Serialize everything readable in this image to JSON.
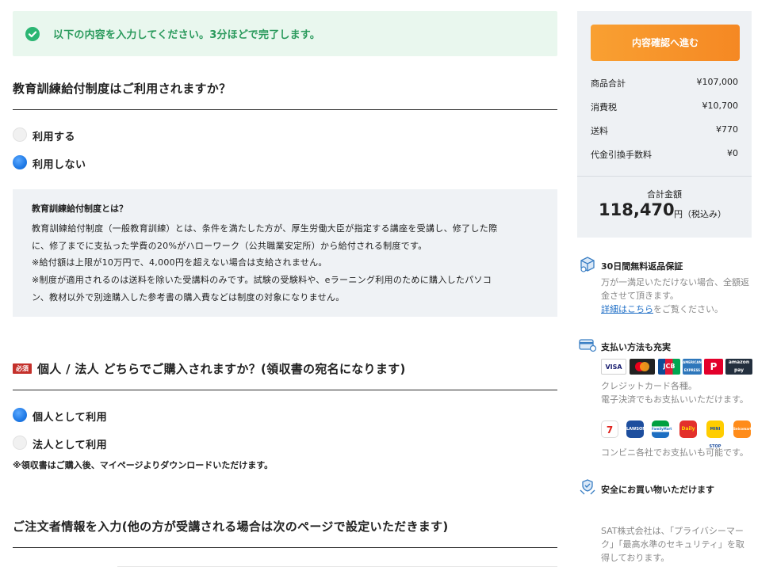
{
  "notice": {
    "text": "以下の内容を入力してください。3分ほどで完了します。"
  },
  "q1": {
    "title": "教育訓練給付制度はご利用されますか？",
    "options": [
      {
        "label": "利用する",
        "selected": false
      },
      {
        "label": "利用しない",
        "selected": true
      }
    ]
  },
  "info": {
    "title": "教育訓練給付制度とは？",
    "lines": [
      "教育訓練給付制度（一般教育訓練）とは、条件を満たした方が、厚生労働大臣が指定する講座を受講し、修了した際",
      "に、修了までに支払った学費の20%がハローワーク（公共職業安定所）から給付される制度です。",
      "※給付額は上限が10万円で、4,000円を超えない場合は支給されません。",
      "※制度が適用されるのは送料を除いた受講料のみです。試験の受験料や、eラーニング利用のために購入したパソコ",
      "ン、教材以外で別途購入した参考書の購入費などは制度の対象になりません。"
    ]
  },
  "q2": {
    "required_badge": "必須",
    "title": "個人 / 法人 どちらでご購入されますか？(領収書の宛名になります)",
    "options": [
      {
        "label": "個人として利用",
        "selected": true
      },
      {
        "label": "法人として利用",
        "selected": false
      }
    ],
    "note": "※領収書はご購入後、マイページよりダウンロードいただけます。"
  },
  "q3": {
    "title": "ご注文者情報を入力(他の方が受講される場合は次のページで設定いただきます)"
  },
  "summary": {
    "cta_label": "内容確認へ進む",
    "rows": [
      {
        "label": "商品合計",
        "value": "¥107,000"
      },
      {
        "label": "消費税",
        "value": "¥10,700"
      },
      {
        "label": "送料",
        "value": "¥770"
      },
      {
        "label": "代金引換手数料",
        "value": "¥0"
      }
    ],
    "total_label": "合計金額",
    "total_value": "118,470",
    "total_unit": "円（税込み）"
  },
  "features": {
    "guarantee": {
      "title": "30日間無料返品保証",
      "desc1": "万が一満足いただけない場合、全額返",
      "desc2": "金させて頂きます。",
      "link": "詳細はこちら",
      "link_suffix": "をご覧ください。"
    },
    "payment": {
      "title": "支払い方法も充実",
      "cards": [
        "VISA",
        "",
        "JCB",
        "AMERICAN EXPRESS",
        "P",
        "amazon pay"
      ],
      "desc1": "クレジットカード各種。",
      "desc2": "電子決済でもお支払いいただけます。",
      "stores": [
        "7",
        "LAWSON",
        "FamilyMart",
        "Daily",
        "MINI STOP",
        "Seicomart"
      ],
      "store_desc": "コンビニ各社でお支払いも可能です。"
    },
    "secure": {
      "title": "安全にお買い物いただけます",
      "desc1": "SAT株式会社は、「プライバシーマー",
      "desc2": "ク」「最高水準のセキュリティ」を取",
      "desc3": "得しております。"
    }
  },
  "colors": {
    "accent_orange": "#f58823",
    "success_green": "#2bb673",
    "radio_blue": "#1f7ae6",
    "required_red": "#c4302b"
  }
}
